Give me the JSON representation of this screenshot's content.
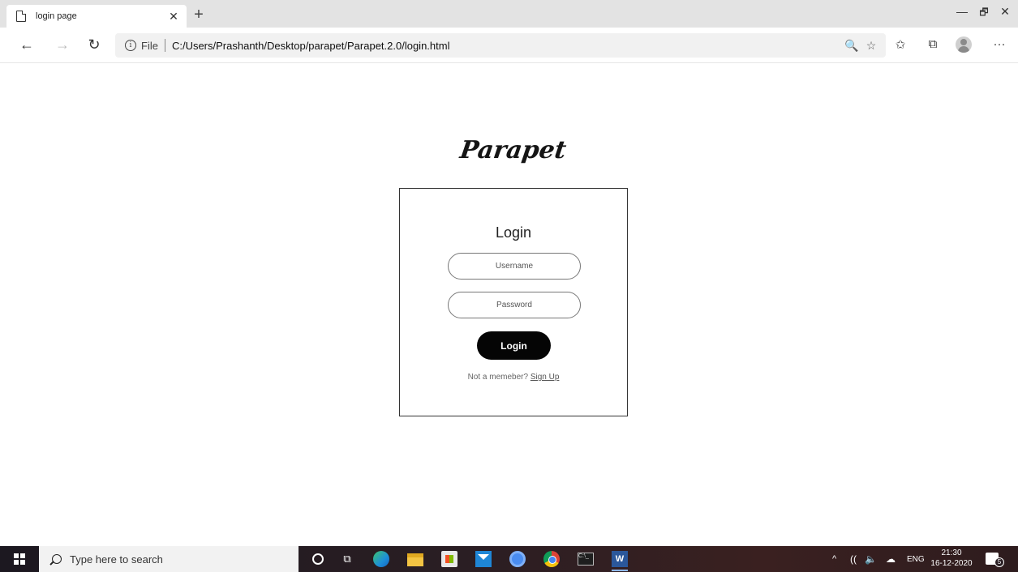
{
  "browser": {
    "tab": {
      "title": "login page",
      "close_glyph": "✕"
    },
    "new_tab_glyph": "+",
    "window_controls": {
      "minimize": "—",
      "maximize": "🗗",
      "close": "✕"
    },
    "nav": {
      "back": "←",
      "forward": "→",
      "refresh": "↻"
    },
    "address": {
      "info_glyph": "i",
      "scheme_label": "File",
      "url": "C:/Users/Prashanth/Desktop/parapet/Parapet.2.0/login.html"
    },
    "omnibox_icons": {
      "zoom": "🔍",
      "favorite": "☆"
    },
    "toolbar_icons": {
      "favorites": "✩",
      "collections": "⧉",
      "more": "···"
    }
  },
  "page": {
    "logo": "Parapet",
    "login": {
      "title": "Login",
      "username_placeholder": "Username",
      "password_placeholder": "Password",
      "button_label": "Login",
      "signup_prompt": "Not a memeber?",
      "signup_link": "Sign Up"
    }
  },
  "taskbar": {
    "search_placeholder": "Type here to search",
    "taskview_glyph": "⧉",
    "terminal_text": "C:\\_",
    "word_glyph": "W",
    "tray": {
      "chevron": "^",
      "wifi": "((",
      "volume": "🔈",
      "cloud": "☁",
      "language": "ENG"
    },
    "clock": {
      "time": "21:30",
      "date": "16-12-2020"
    },
    "notifications_count": "5"
  }
}
